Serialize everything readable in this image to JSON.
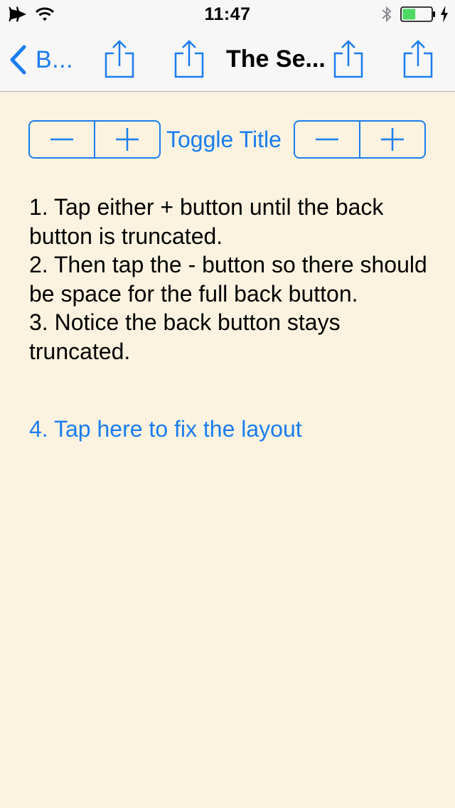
{
  "status_bar": {
    "time": "11:47",
    "left_icons": [
      "airplane-icon",
      "wifi-icon"
    ],
    "right_icons": [
      "bluetooth-icon",
      "battery-icon",
      "charging-icon"
    ],
    "battery_level": 0.45,
    "battery_color": "#4CD964"
  },
  "nav_bar": {
    "back_label": "B...",
    "title": "The Se...",
    "share_buttons": [
      "share-icon",
      "share-icon",
      "share-icon",
      "share-icon"
    ]
  },
  "controls": {
    "stepper_minus": "−",
    "stepper_plus": "+",
    "toggle_title_label": "Toggle Title"
  },
  "instructions": [
    "1. Tap either + button until the back button is truncated.",
    "2. Then tap the - button so there should be space for the full back button.",
    "3. Notice the back button stays truncated."
  ],
  "fix_link_label": "4. Tap here to fix the layout",
  "colors": {
    "accent": "#1A7CF0",
    "background": "#FBF3DF",
    "bar_background": "#F7F7F7"
  }
}
